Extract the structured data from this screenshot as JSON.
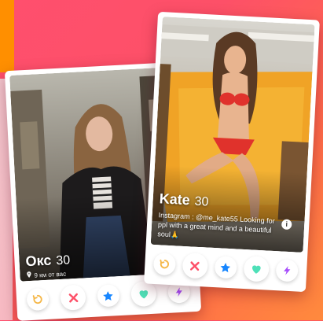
{
  "cards": {
    "left": {
      "name": "Окс",
      "age": "30",
      "distance": "9 км от вас"
    },
    "right": {
      "name": "Kate",
      "age": "30",
      "bio": "Instagram : @me_kate55 Looking for ppl with a great mind and a beautiful soul🙏",
      "info_glyph": "i"
    }
  },
  "actions": [
    "rewind-icon",
    "nope-icon",
    "super-like-icon",
    "like-icon",
    "boost-icon"
  ],
  "colors": {
    "rewind": "#f5b748",
    "nope": "#fd5068",
    "super_like": "#1786ff",
    "like": "#4ee0b8",
    "boost": "#a74efc"
  }
}
